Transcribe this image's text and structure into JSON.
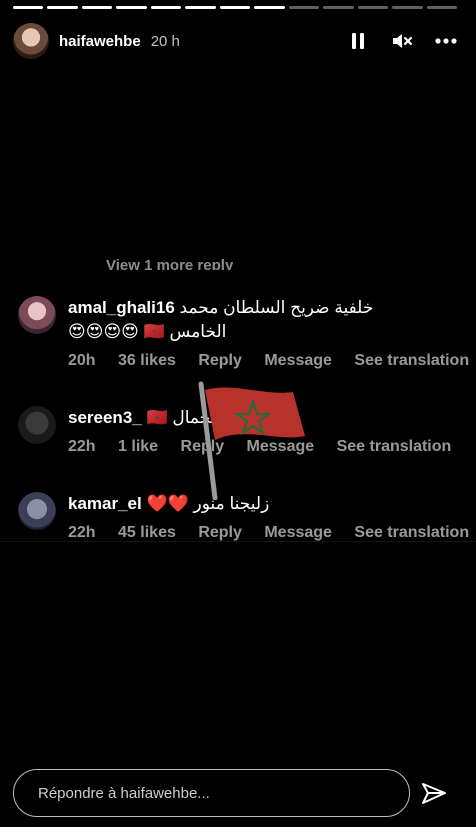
{
  "story": {
    "progress_segments": 13,
    "segments_viewed": 8,
    "username": "haifawehbe",
    "time_ago": "20 h"
  },
  "icons": {
    "pause": "pause-icon",
    "mute": "speaker-muted-icon",
    "more": "more-horizontal-icon",
    "send": "send-icon"
  },
  "comments": {
    "view_more": "View 1 more reply",
    "items": [
      {
        "username": "amal_ghali16",
        "text_line1": "خلفية ضريح السلطان محمد",
        "text_line2": "الخامس 🇲🇦 😍😍😍😍",
        "time": "20h",
        "likes": "36 likes",
        "reply": "Reply",
        "message": "Message",
        "see_translation": "See translation"
      },
      {
        "username": "sereen3_",
        "text_line1": "الجمال 🇲🇦",
        "time": "22h",
        "likes": "1 like",
        "reply": "Reply",
        "message": "Message",
        "see_translation": "See translation"
      },
      {
        "username": "kamar_el",
        "text_line1": "زليجنا منور ❤️❤️",
        "time": "22h",
        "likes": "45 likes",
        "reply": "Reply",
        "message": "Message",
        "see_translation": "See translation"
      }
    ]
  },
  "reply_bar": {
    "placeholder": "Répondre à haifawehbe..."
  },
  "colors": {
    "background": "#000000",
    "flag_red": "#b8322c",
    "flag_star": "#1f6b3a"
  }
}
